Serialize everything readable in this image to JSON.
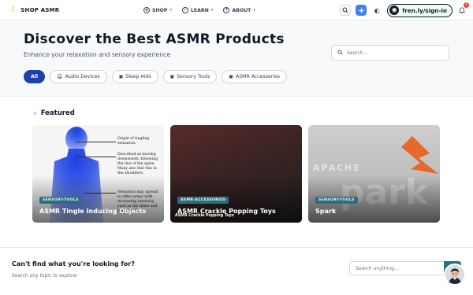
{
  "brand": {
    "name": "SHOP ASMR"
  },
  "nav": [
    {
      "label": "SHOP",
      "icon": "compass-icon"
    },
    {
      "label": "LEARN",
      "icon": "check-circle-icon"
    },
    {
      "label": "ABOUT",
      "icon": "question-circle-icon"
    }
  ],
  "toolbar": {
    "signin_label": "fren.ly/sign-in",
    "notification_count": "1"
  },
  "hero": {
    "title": "Discover the Best ASMR Products",
    "subtitle": "Enhance your relaxation and sensory experience",
    "search_placeholder": "Search..."
  },
  "filters": [
    {
      "label": "All",
      "active": true
    },
    {
      "label": "Audio Devices",
      "icon": "headphones-icon"
    },
    {
      "label": "Sleep Aids",
      "icon": "bag-icon"
    },
    {
      "label": "Sensory Tools",
      "icon": "bag-icon"
    },
    {
      "label": "ASMR Accessories",
      "icon": "bag-icon"
    }
  ],
  "featured": {
    "heading": "Featured",
    "cards": [
      {
        "tag": "SENSORY-TOOLS",
        "title": "ASMR Tingle Inducing Objects",
        "annotations": [
          "Origin of tingling sensation.",
          "Described as moving downwards, following the line of the spine. Many also feel this in the shoulders.",
          "Sensation may spread to other areas with increasing intensity, such as the limbs and lower back."
        ]
      },
      {
        "tag": "ASMR-ACCESSORIES",
        "title": "ASMR Crackle Popping Toys",
        "image_caption": "ASMR Crackle Popping Toys"
      },
      {
        "tag": "SENSORY-TOOLS",
        "title": "Spark",
        "image_text": "APACHE"
      }
    ]
  },
  "bottom": {
    "question": "Can't find what you're looking for?",
    "hint": "Search any topic to explore",
    "search_placeholder": "Search anything..."
  },
  "colors": {
    "accent": "#1e40af",
    "tag": "#2c6e7f",
    "spark_orange": "#e8672a",
    "badge": "#ef4444"
  }
}
